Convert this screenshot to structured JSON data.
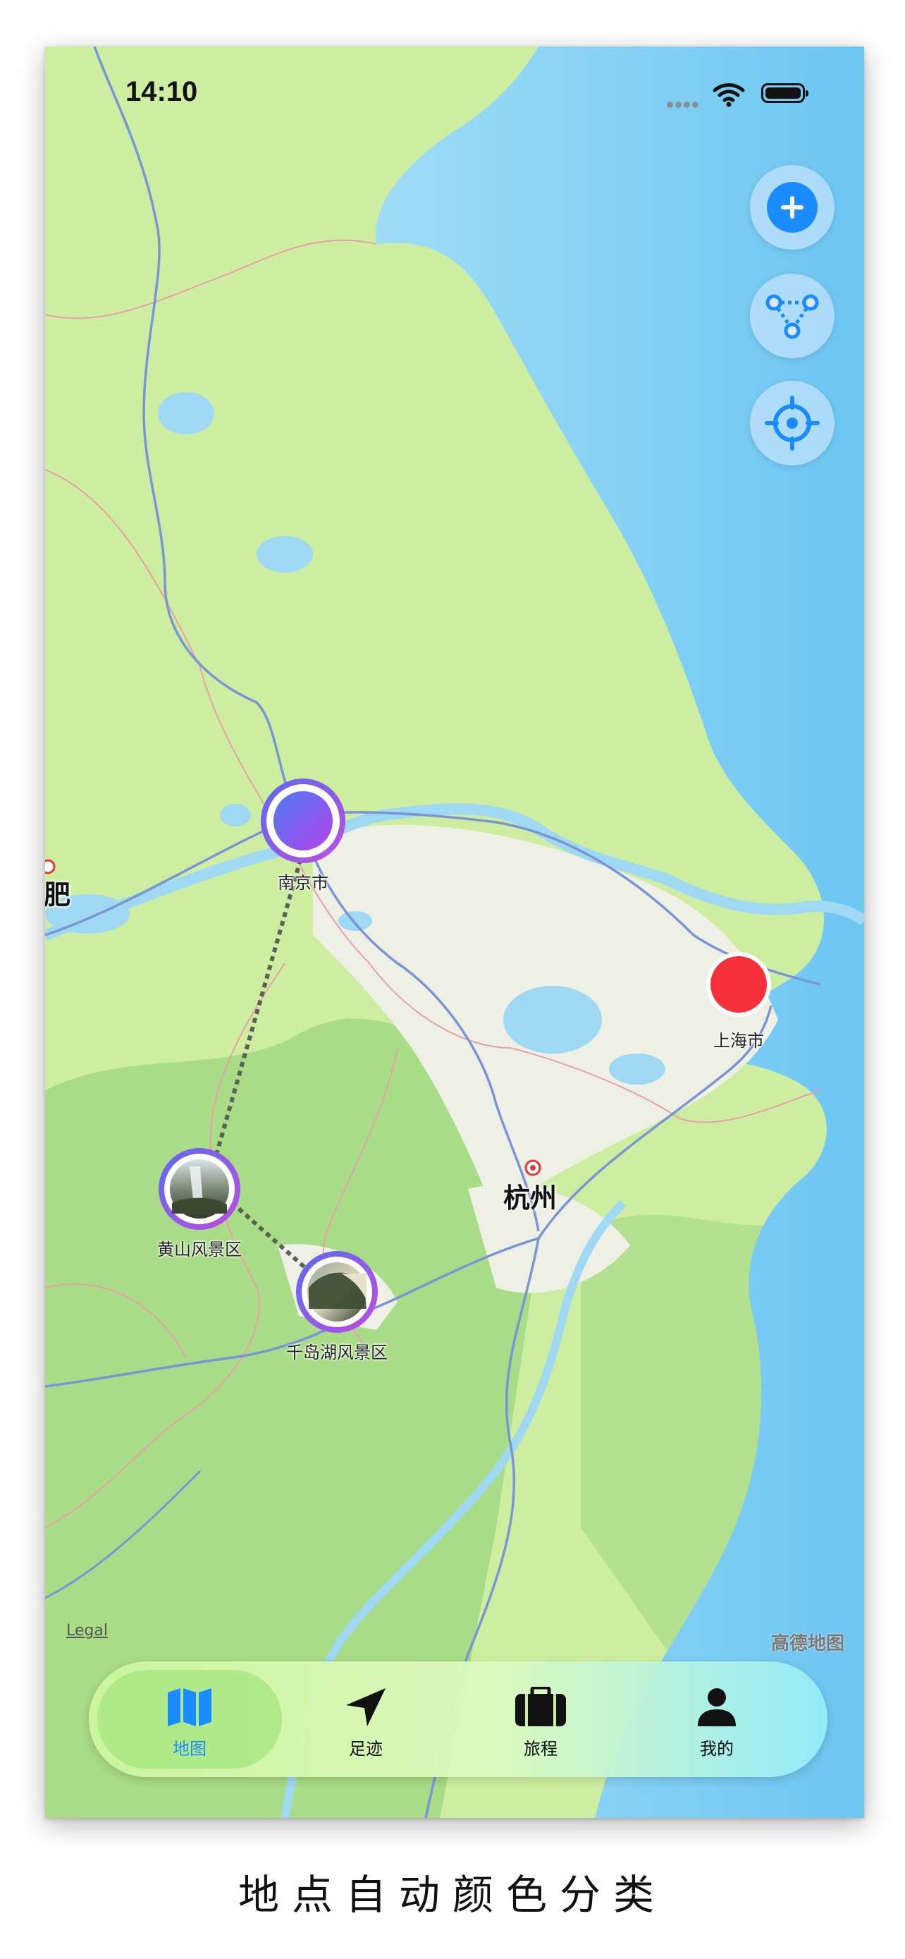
{
  "status_bar": {
    "time": "14:10"
  },
  "map": {
    "pins": [
      {
        "label": "南京市",
        "kind": "gradient"
      },
      {
        "label": "黄山风景区",
        "kind": "photo"
      },
      {
        "label": "千岛湖风景区",
        "kind": "photo"
      },
      {
        "label": "上海市",
        "kind": "red"
      }
    ],
    "city_labels": {
      "hangzhou": "杭州",
      "hefei_partial": "肥"
    },
    "legal": "Legal",
    "provider": "高德地图"
  },
  "controls": {
    "add_icon": "plus-circle-icon",
    "route_icon": "route-nodes-icon",
    "locate_icon": "crosshair-icon"
  },
  "tabs": [
    {
      "label": "地图",
      "icon": "map-icon",
      "active": true
    },
    {
      "label": "足迹",
      "icon": "location-arrow-icon",
      "active": false
    },
    {
      "label": "旅程",
      "icon": "suitcase-icon",
      "active": false
    },
    {
      "label": "我的",
      "icon": "person-icon",
      "active": false
    }
  ],
  "colors": {
    "accent": "#1a8cff",
    "pin_red": "#f5303a",
    "pin_purple": "#8a4cf0",
    "land": "#cdeea0",
    "water": "#78ccf4"
  },
  "caption": "地点自动颜色分类"
}
